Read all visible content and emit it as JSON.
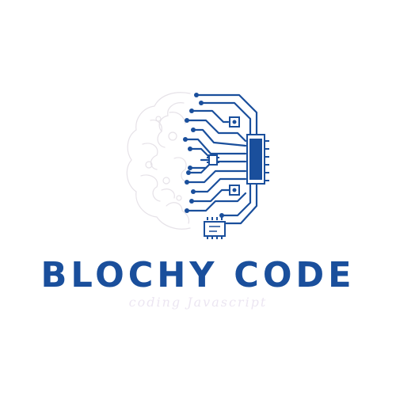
{
  "logo": {
    "icon": "brain-circuit-icon",
    "colors": {
      "circuit": "#1a4f9c",
      "brain_outline": "#e6e2e8",
      "background": "#ffffff"
    }
  },
  "brand": {
    "name": "BLOCHY CODE",
    "tagline": "coding Javascript",
    "color": "#1a4f9c",
    "tagline_color": "#ece6f2"
  }
}
